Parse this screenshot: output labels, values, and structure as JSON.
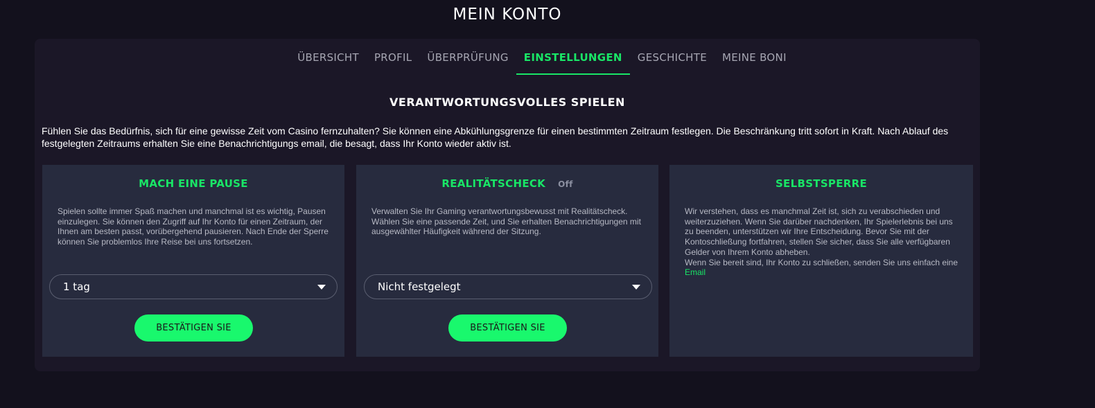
{
  "page_title": "MEIN KONTO",
  "tabs": [
    {
      "label": "ÜBERSICHT"
    },
    {
      "label": "PROFIL"
    },
    {
      "label": "ÜBERPRÜFUNG"
    },
    {
      "label": "EINSTELLUNGEN"
    },
    {
      "label": "GESCHICHTE"
    },
    {
      "label": "MEINE BONI"
    }
  ],
  "active_tab": "EINSTELLUNGEN",
  "section_title": "VERANTWORTUNGSVOLLES SPIELEN",
  "intro_text": "Fühlen Sie das Bedürfnis, sich für eine gewisse Zeit vom Casino fernzuhalten? Sie können eine Abkühlungsgrenze für einen bestimmten Zeitraum festlegen. Die Beschränkung tritt sofort in Kraft. Nach Ablauf des festgelegten Zeitraums erhalten Sie eine Benachrichtigungs email, die besagt, dass Ihr Konto wieder aktiv ist.",
  "cards": {
    "pause": {
      "title": "MACH EINE PAUSE",
      "text": "Spielen sollte immer Spaß machen und manchmal ist es wichtig, Pausen einzulegen. Sie können den Zugriff auf Ihr Konto für einen Zeitraum, der Ihnen am besten passt, vorübergehend pausieren. Nach Ende der Sperre können Sie problemlos Ihre Reise bei uns fortsetzen.",
      "select_value": "1 tag",
      "button_label": "BESTÄTIGEN SIE"
    },
    "reality": {
      "title": "REALITÄTSCHECK",
      "status": "Off",
      "text": "Verwalten Sie Ihr Gaming verantwortungsbewusst mit Realitätscheck. Wählen Sie eine passende Zeit, und Sie erhalten Benachrichtigungen mit ausgewählter Häufigkeit während der Sitzung.",
      "select_value": "Nicht festgelegt",
      "button_label": "BESTÄTIGEN SIE"
    },
    "selfban": {
      "title": "SELBSTSPERRE",
      "text": "Wir verstehen, dass es manchmal Zeit ist, sich zu verabschieden und weiterzuziehen. Wenn Sie darüber nachdenken, Ihr Spielerlebnis bei uns zu beenden, unterstützen wir Ihre Entscheidung. Bevor Sie mit der Kontoschließung fortfahren, stellen Sie sicher, dass Sie alle verfügbaren Gelder von Ihrem Konto abheben.",
      "text2": "Wenn Sie bereit sind, Ihr Konto zu schließen, senden Sie uns einfach eine",
      "email_label": "Email"
    }
  },
  "colors": {
    "accent": "#19e566",
    "button": "#19f86d",
    "background": "#13111d",
    "panel": "#1b1727",
    "card": "#272b3e"
  },
  "icons": {
    "select_caret": "caret-down-icon"
  }
}
